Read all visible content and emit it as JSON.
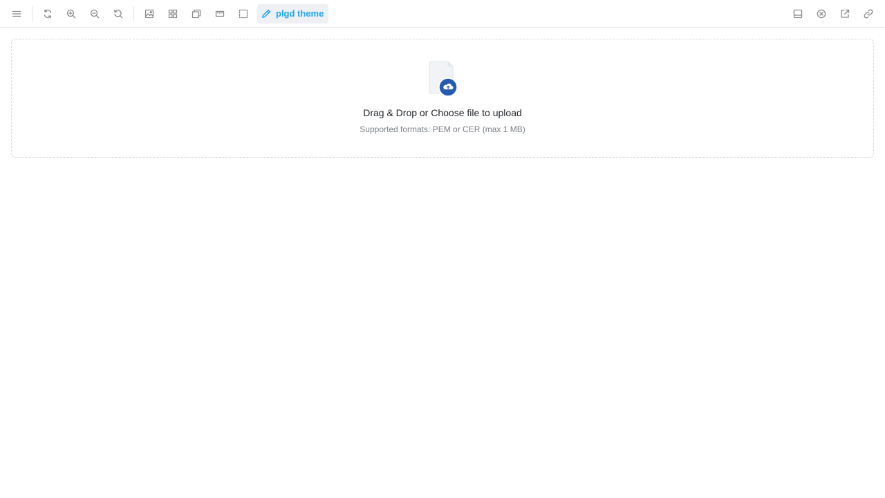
{
  "toolbar": {
    "theme_label": "plgd theme",
    "accent_color": "#1ea7fd",
    "left_icons": [
      "menu-icon",
      "reload-icon",
      "zoom-in-icon",
      "zoom-out-icon",
      "reset-zoom-icon",
      "background-icon",
      "grid-icon",
      "outline-icon",
      "measure-icon",
      "viewport-icon"
    ],
    "right_icons": [
      "addons-panel-icon",
      "close-icon",
      "open-new-tab-icon",
      "copy-link-icon"
    ]
  },
  "upload": {
    "title": "Drag & Drop or Choose file to upload",
    "subtitle": "Supported formats: PEM or CER (max 1 MB)",
    "icon": "file-upload-icon",
    "badge_color": "#255bb1"
  }
}
